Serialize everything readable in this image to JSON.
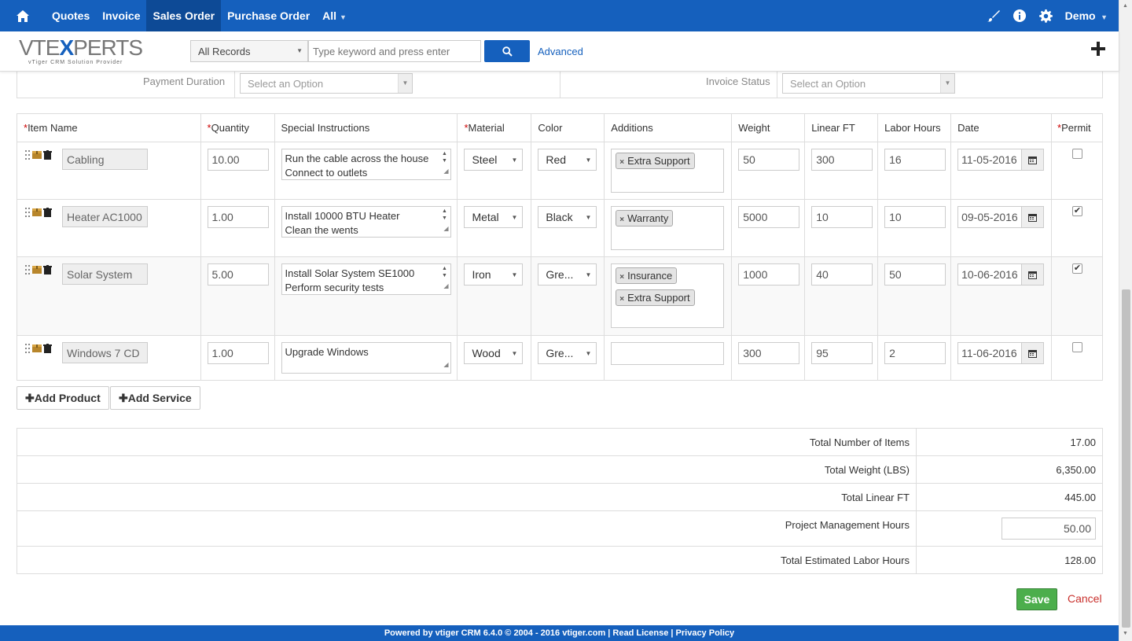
{
  "nav": {
    "items": [
      "Quotes",
      "Invoice",
      "Sales Order",
      "Purchase Order",
      "All"
    ],
    "user": "Demo"
  },
  "header": {
    "logo_main_a": "VTE",
    "logo_main_b": "X",
    "logo_main_c": "PERTS",
    "logo_sub": "vTiger CRM Solution Provider",
    "records_select": "All Records",
    "search_placeholder": "Type keyword and press enter",
    "advanced": "Advanced"
  },
  "top_block": {
    "payment_duration_label": "Payment Duration",
    "payment_duration_value": "Select an Option",
    "invoice_status_label": "Invoice Status",
    "invoice_status_value": "Select an Option"
  },
  "columns": [
    "Item Name",
    "Quantity",
    "Special Instructions",
    "Material",
    "Color",
    "Additions",
    "Weight",
    "Linear FT",
    "Labor Hours",
    "Date",
    "Permit"
  ],
  "rows": [
    {
      "name": "Cabling",
      "qty": "10.00",
      "instr1": "Run the cable across the house",
      "instr2": "Connect to outlets",
      "material": "Steel",
      "color": "Red",
      "add1": "Extra Support",
      "add2": "",
      "weight": "50",
      "linear": "300",
      "labor": "16",
      "date": "11-05-2016",
      "permit": ""
    },
    {
      "name": "Heater AC1000",
      "qty": "1.00",
      "instr1": "Install 10000 BTU Heater",
      "instr2": "Clean the wents",
      "material": "Metal",
      "color": "Black",
      "add1": "Warranty",
      "add2": "",
      "weight": "5000",
      "linear": "10",
      "labor": "10",
      "date": "09-05-2016",
      "permit": "✔"
    },
    {
      "name": "Solar System",
      "qty": "5.00",
      "instr1": "Install Solar System SE1000",
      "instr2": "Perform security tests",
      "material": "Iron",
      "color": "Gre...",
      "add1": "Insurance",
      "add2": "Extra Support",
      "weight": "1000",
      "linear": "40",
      "labor": "50",
      "date": "10-06-2016",
      "permit": "✔"
    },
    {
      "name": "Windows 7 CD",
      "qty": "1.00",
      "instr1": "Upgrade Windows",
      "instr2": "",
      "material": "Wood",
      "color": "Gre...",
      "add1": "",
      "add2": "",
      "weight": "300",
      "linear": "95",
      "labor": "2",
      "date": "11-06-2016",
      "permit": ""
    }
  ],
  "buttons": {
    "add_product": "Add Product",
    "add_service": "Add Service",
    "save": "Save",
    "cancel": "Cancel"
  },
  "totals": [
    {
      "label": "Total Number of Items",
      "value": "17.00"
    },
    {
      "label": "Total Weight (LBS)",
      "value": "6,350.00"
    },
    {
      "label": "Total Linear FT",
      "value": "445.00"
    },
    {
      "label": "Project Management Hours",
      "value": "50.00"
    },
    {
      "label": "Total Estimated Labor Hours",
      "value": "128.00"
    }
  ],
  "footer": "Powered by vtiger CRM 6.4.0  © 2004 - 2016  vtiger.com | Read License | Privacy Policy",
  "colors": {
    "brand": "#1560bd",
    "save": "#4cae4c",
    "cancel": "#c9302c",
    "required": "#cc0000"
  }
}
